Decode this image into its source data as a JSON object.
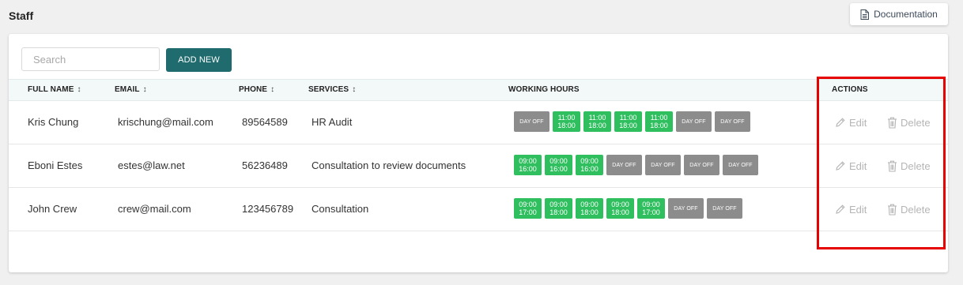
{
  "page": {
    "title": "Staff"
  },
  "documentation": {
    "label": "Documentation"
  },
  "search": {
    "placeholder": "Search",
    "value": ""
  },
  "add_new": {
    "label": "ADD NEW"
  },
  "columns": {
    "full_name": "FULL NAME",
    "email": "EMAIL",
    "phone": "PHONE",
    "services": "SERVICES",
    "working_hours": "WORKING HOURS",
    "actions": "ACTIONS"
  },
  "sort_glyph": "↕",
  "actions": {
    "edit": "Edit",
    "delete": "Delete"
  },
  "colors": {
    "accent": "#1f6b6d",
    "work_slot": "#2fbf5f",
    "day_off": "#8c8c8c",
    "highlight": "#e60000"
  },
  "rows": [
    {
      "name": "Kris Chung",
      "email": "krischung@mail.com",
      "phone": "89564589",
      "service": "HR Audit",
      "hours": [
        {
          "type": "off",
          "text": "DAY OFF"
        },
        {
          "type": "work",
          "start": "11:00",
          "end": "18:00"
        },
        {
          "type": "work",
          "start": "11:00",
          "end": "18:00"
        },
        {
          "type": "work",
          "start": "11:00",
          "end": "18:00"
        },
        {
          "type": "work",
          "start": "11:00",
          "end": "18:00"
        },
        {
          "type": "off",
          "text": "DAY OFF"
        },
        {
          "type": "off",
          "text": "DAY OFF"
        }
      ]
    },
    {
      "name": "Eboni Estes",
      "email": "estes@law.net",
      "phone": "56236489",
      "service": "Consultation to review documents",
      "hours": [
        {
          "type": "work",
          "start": "09:00",
          "end": "16:00"
        },
        {
          "type": "work",
          "start": "09:00",
          "end": "16:00"
        },
        {
          "type": "work",
          "start": "09:00",
          "end": "16:00"
        },
        {
          "type": "off",
          "text": "DAY OFF"
        },
        {
          "type": "off",
          "text": "DAY OFF"
        },
        {
          "type": "off",
          "text": "DAY OFF"
        },
        {
          "type": "off",
          "text": "DAY OFF"
        }
      ]
    },
    {
      "name": "John Crew",
      "email": "crew@mail.com",
      "phone": "123456789",
      "service": "Consultation",
      "hours": [
        {
          "type": "work",
          "start": "09:00",
          "end": "17:00"
        },
        {
          "type": "work",
          "start": "09:00",
          "end": "18:00"
        },
        {
          "type": "work",
          "start": "09:00",
          "end": "18:00"
        },
        {
          "type": "work",
          "start": "09:00",
          "end": "18:00"
        },
        {
          "type": "work",
          "start": "09:00",
          "end": "17:00"
        },
        {
          "type": "off",
          "text": "DAY OFF"
        },
        {
          "type": "off",
          "text": "DAY OFF"
        }
      ]
    }
  ]
}
